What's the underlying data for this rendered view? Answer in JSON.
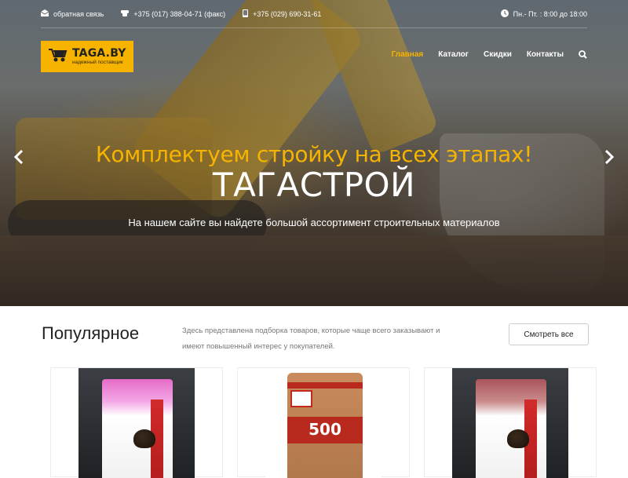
{
  "topbar": {
    "feedback": "обратная связь",
    "phone_fax": "+375 (017) 388-04-71 (факс)",
    "phone_mobile": "+375 (029) 690-31-61",
    "hours": "Пн.- Пт. : 8:00 до 18:00"
  },
  "logo": {
    "title": "TAGA.BY",
    "subtitle": "надежный поставщик"
  },
  "nav": {
    "items": [
      "Главная",
      "Каталог",
      "Скидки",
      "Контакты"
    ],
    "active": "Главная"
  },
  "hero": {
    "title": "Комплектуем стройку на всех этапах!",
    "brand": "ТАГАСТРОЙ",
    "subtitle": "На нашем сайте вы найдете большой ассортимент строительных материалов"
  },
  "popular": {
    "heading": "Популярное",
    "description": "Здесь представлена подборка товаров, которые чаще всего заказывают и имеют повышенный интерес у покупателей.",
    "button": "Смотреть все"
  },
  "products": [
    {
      "image": "pink-mortar-bag"
    },
    {
      "image": "cement-500-bag",
      "badge": "500"
    },
    {
      "image": "rose-mortar-bag"
    }
  ],
  "colors": {
    "accent": "#f6b400",
    "text_dark": "#222222",
    "text_muted": "#777777"
  },
  "icons": [
    "envelope-icon",
    "phone-icon",
    "mobile-icon",
    "clock-icon",
    "search-icon",
    "wheelbarrow-icon",
    "chevron-left-icon",
    "chevron-right-icon"
  ]
}
